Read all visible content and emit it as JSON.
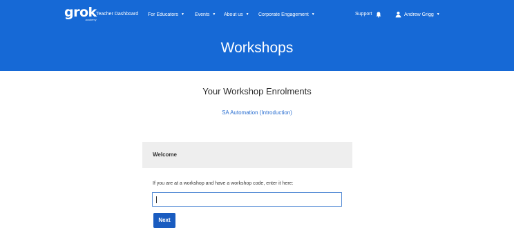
{
  "nav": {
    "logo_text": "grok",
    "logo_sub": "academy",
    "items": [
      {
        "label": "Teacher Dashboard",
        "dropdown": false
      },
      {
        "label": "For Educators",
        "dropdown": true
      },
      {
        "label": "Events",
        "dropdown": true
      },
      {
        "label": "About us",
        "dropdown": true
      },
      {
        "label": "Corporate Engagement",
        "dropdown": true
      }
    ],
    "support": "Support",
    "user_name": "Andrew Grigg",
    "icons": [
      "bell-icon",
      "user-icon",
      "chevron-down-icon"
    ]
  },
  "header": {
    "title": "Workshops"
  },
  "main": {
    "section_title": "Your Workshop Enrolments",
    "enrolments": [
      "SA Automation (Introduction)"
    ],
    "panel_title": "Welcome",
    "prompt": "If you are at a workshop and have a workshop code, enter it here:",
    "code_value": "",
    "next_label": "Next"
  },
  "colors": {
    "header_bg": "#1669d6",
    "link": "#2a6fd1",
    "button_bg": "#1a5cc0",
    "panel_bg": "#eeeeee"
  }
}
